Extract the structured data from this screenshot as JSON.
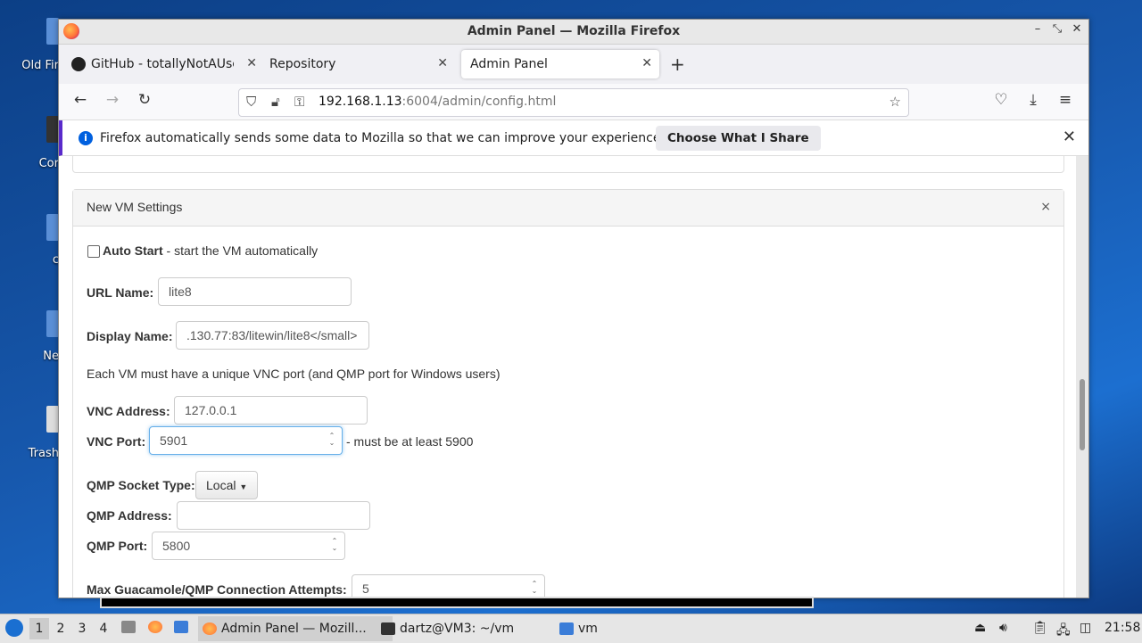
{
  "desktop": {
    "icons": [
      "Old Fir",
      "Cor",
      "c",
      "Ne",
      "Trash"
    ]
  },
  "window": {
    "title": "Admin Panel — Mozilla Firefox",
    "controls": {
      "minimize": "–",
      "restore": "⤡",
      "close": "✕"
    }
  },
  "tabs": [
    {
      "label": "GitHub - totallyNotAUser/",
      "icon": "github-icon"
    },
    {
      "label": "Repository"
    },
    {
      "label": "Admin Panel"
    }
  ],
  "nav": {
    "url_host": "192.168.1.13",
    "url_rest": ":6004/admin/config.html"
  },
  "notification": {
    "message": "Firefox automatically sends some data to Mozilla so that we can improve your experience.",
    "button": "Choose What I Share"
  },
  "panel": {
    "title": "New VM Settings",
    "close": "×",
    "autostart_label": "Auto Start",
    "autostart_desc": " - start the VM automatically",
    "url_name_label": "URL Name:",
    "url_name_value": "lite8",
    "display_name_label": "Display Name:",
    "display_name_value": ".130.77:83/litewin/lite8</small>",
    "vnc_note": "Each VM must have a unique VNC port (and QMP port for Windows users)",
    "vnc_address_label": "VNC Address:",
    "vnc_address_value": "127.0.0.1",
    "vnc_port_label": "VNC Port:",
    "vnc_port_value": "5901",
    "vnc_port_hint": "- must be at least 5900",
    "qmp_socket_label": "QMP Socket Type:",
    "qmp_socket_value": "Local",
    "qmp_address_label": "QMP Address:",
    "qmp_address_value": "",
    "qmp_port_label": "QMP Port:",
    "qmp_port_value": "5800",
    "max_attempts_label": "Max Guacamole/QMP Connection Attempts:",
    "max_attempts_value": "5"
  },
  "taskbar": {
    "workspaces": [
      "1",
      "2",
      "3",
      "4"
    ],
    "tasks": [
      {
        "label": "Admin Panel — Mozill...",
        "icon": "firefox-icon"
      },
      {
        "label": "dartz@VM3: ~/vm",
        "icon": "terminal-icon"
      },
      {
        "label": "vm",
        "icon": "folder-icon"
      }
    ],
    "clock": "21:58"
  }
}
